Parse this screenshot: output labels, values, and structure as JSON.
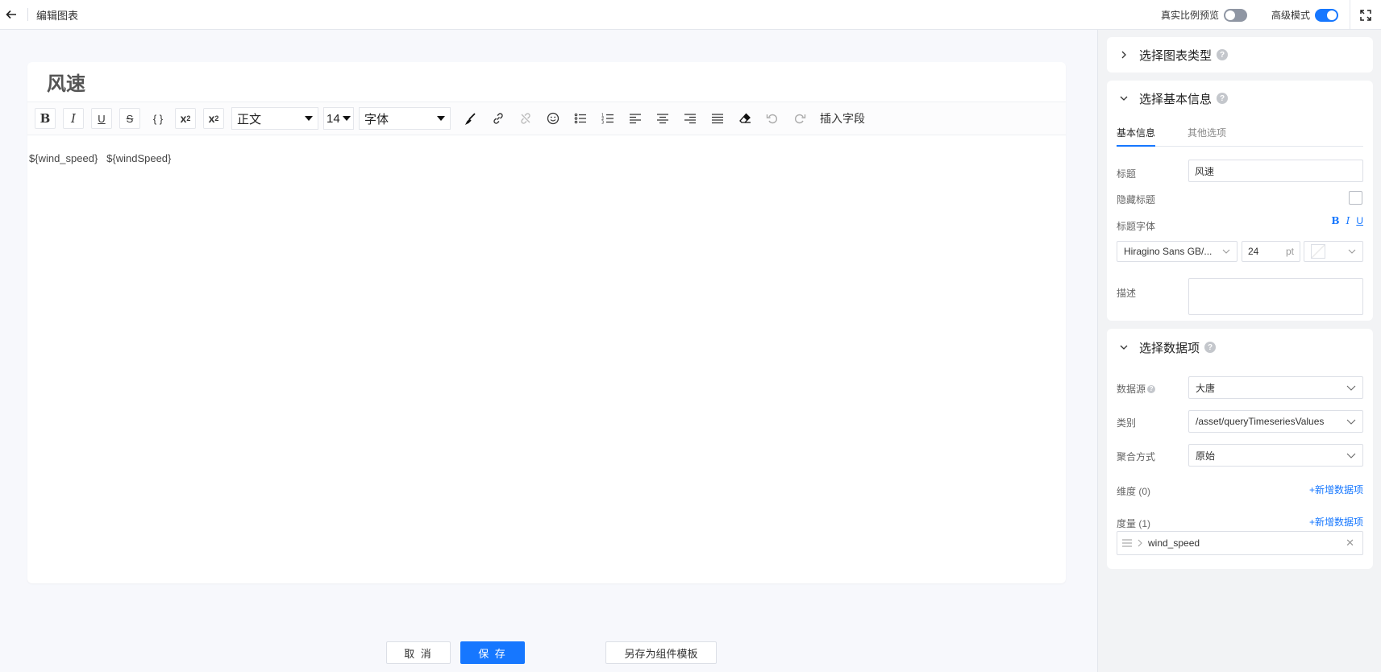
{
  "header": {
    "title": "编辑图表",
    "real_ratio_label": "真实比例预览",
    "real_ratio_on": false,
    "advanced_label": "高级模式",
    "advanced_on": true
  },
  "editor": {
    "chart_title": "风速",
    "paragraph_select": "正文",
    "font_size_select": "14",
    "font_family_select": "字体",
    "insert_field_label": "插入字段",
    "body_text": "${wind_speed}   ${windSpeed}"
  },
  "buttons": {
    "cancel": "取 消",
    "save": "保 存",
    "save_template": "另存为组件模板"
  },
  "panel": {
    "section_chart_type": "选择图表类型",
    "section_basic_info": "选择基本信息",
    "tabs": [
      "基本信息",
      "其他选项"
    ],
    "title_label": "标题",
    "title_value": "风速",
    "hide_title_label": "隐藏标题",
    "title_font_label": "标题字体",
    "bold": "B",
    "italic": "I",
    "underline": "U",
    "font_family_value": "Hiragino Sans GB/...",
    "font_size_value": "24",
    "font_size_unit": "pt",
    "description_label": "描述",
    "section_data_items": "选择数据项",
    "datasource_label": "数据源",
    "datasource_value": "大唐",
    "category_label": "类别",
    "category_value": "/asset/queryTimeseriesValues",
    "aggregation_label": "聚合方式",
    "aggregation_value": "原始",
    "dimension_label": "维度 (0)",
    "measure_label": "度量 (1)",
    "add_data_item": "+新增数据项",
    "measure_item": "wind_speed"
  },
  "colors": {
    "accent": "#1677ff"
  }
}
